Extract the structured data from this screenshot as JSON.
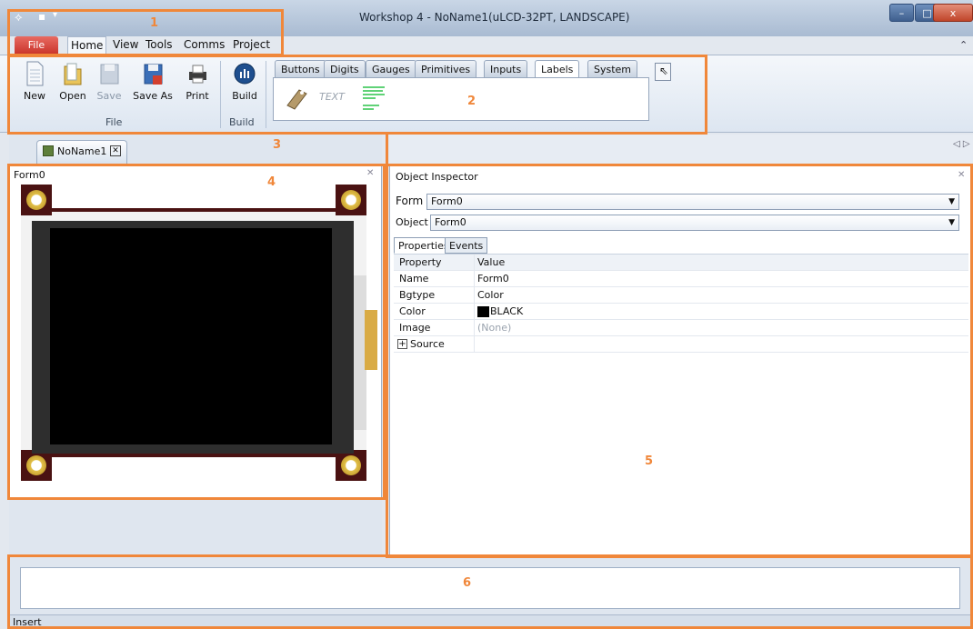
{
  "window": {
    "title": "Workshop 4 - NoName1(uLCD-32PT, LANDSCAPE)",
    "minimize": "–",
    "maximize": "□",
    "close": "x",
    "collapse_ribbon": "⌃"
  },
  "menu": {
    "file": "File",
    "items": [
      "Home",
      "View",
      "Tools",
      "Comms",
      "Project"
    ]
  },
  "ribbon": {
    "file_group": {
      "label": "File",
      "buttons": [
        "New",
        "Open",
        "Save",
        "Save As",
        "Print"
      ]
    },
    "build_group": {
      "label": "Build",
      "button": "Build"
    },
    "palette_tabs": [
      "Buttons",
      "Digits",
      "Gauges",
      "Primitives",
      "Inputs",
      "Labels",
      "System"
    ],
    "palette_active": "Labels",
    "palette_text_widget": "TEXT"
  },
  "document": {
    "tab": "NoName1",
    "form_title": "Form0",
    "tab_arrows": "◁ ▷"
  },
  "inspector": {
    "title": "Object Inspector",
    "form_label": "Form",
    "form_value": "Form0",
    "object_label": "Object",
    "object_value": "Form0",
    "tabs": [
      "Properties",
      "Events"
    ],
    "headers": [
      "Property",
      "Value"
    ],
    "rows": [
      {
        "property": "Name",
        "value": "Form0"
      },
      {
        "property": "Bgtype",
        "value": "Color"
      },
      {
        "property": "Color",
        "value": "BLACK"
      },
      {
        "property": "Image",
        "value": "(None)"
      },
      {
        "property": "Source",
        "value": ""
      }
    ]
  },
  "status": {
    "mode": "Insert"
  },
  "annotations": [
    "1",
    "2",
    "3",
    "4",
    "5",
    "6"
  ],
  "colors": {
    "annotation": "#f0873a",
    "file_tab": "#c9332a",
    "lcd_screen": "#000000",
    "lcd_bezel": "#2e2e2e",
    "color_swatch": "#000000"
  }
}
